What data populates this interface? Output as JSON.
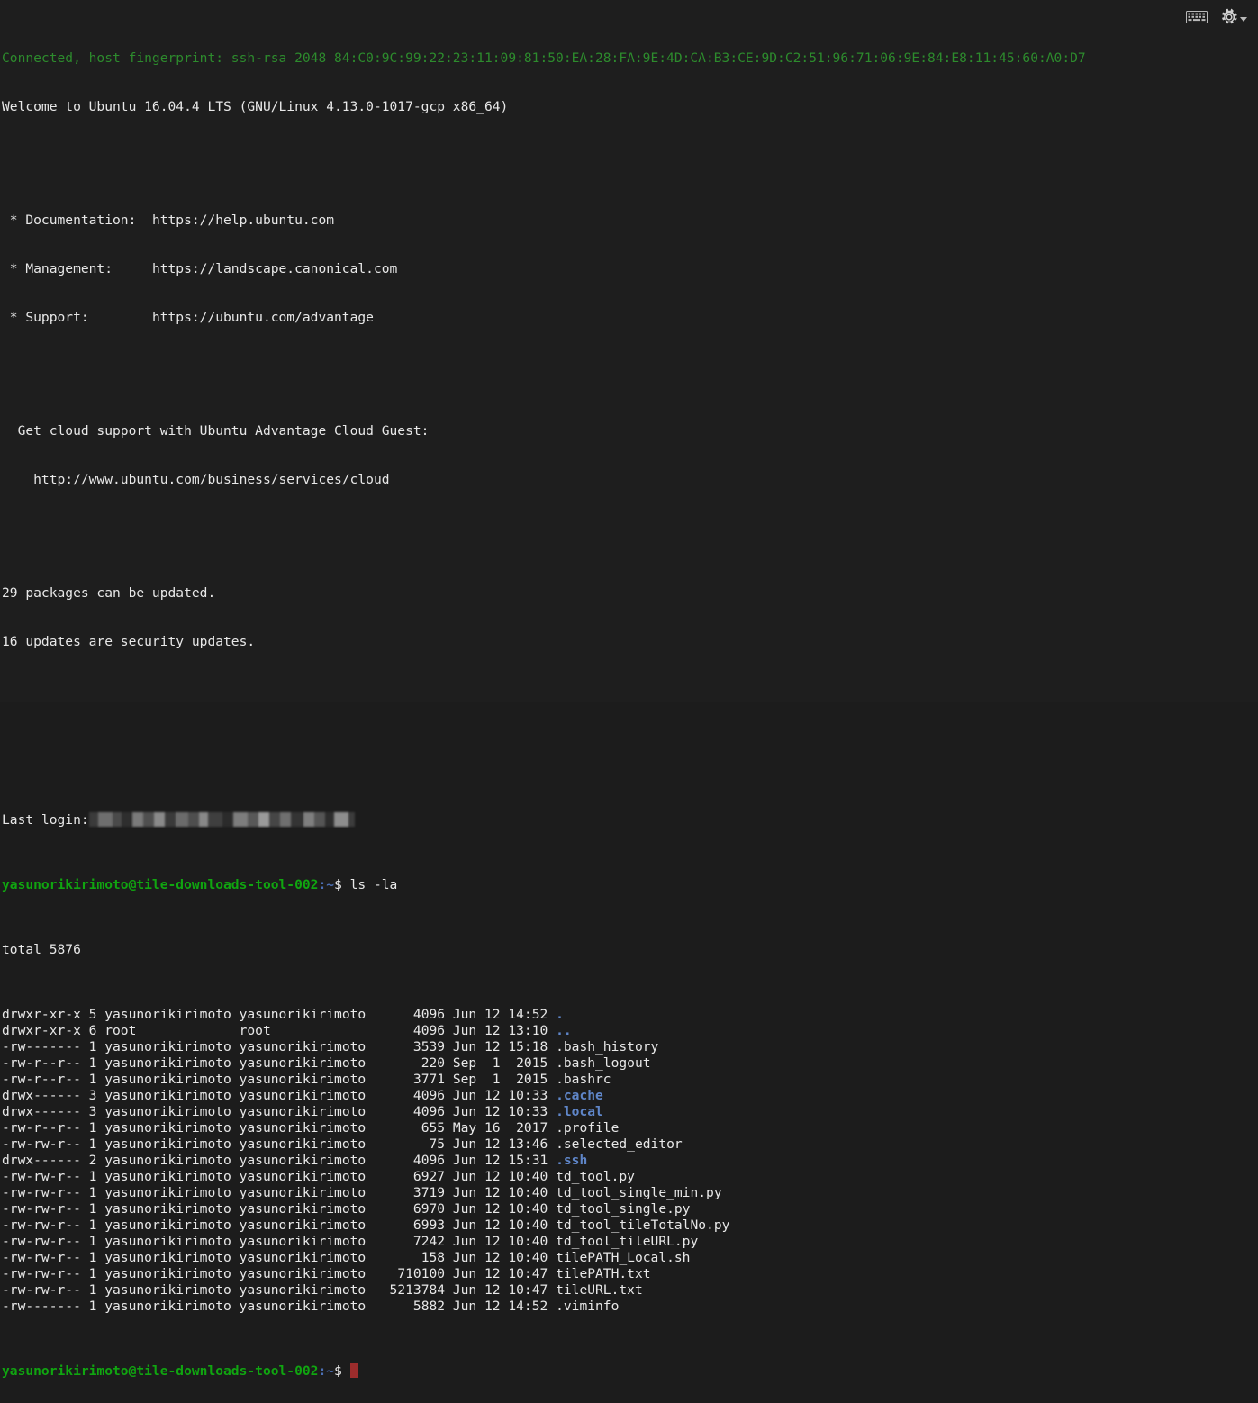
{
  "window": {
    "title": "SSH Terminal Session",
    "background_color": "#1e1e1e",
    "foreground_color": "#e6e6e6"
  },
  "toolbar": {
    "keyboard_icon": "keyboard-icon",
    "gear_icon": "gear-icon",
    "caret_icon": "chevron-down-icon"
  },
  "colors": {
    "prompt_green": "#10a510",
    "banner_green": "#2d8b2d",
    "directory_blue": "#5f86c9",
    "cursor_red": "#9c2c2c",
    "text_white": "#e8e8e8"
  },
  "banner": {
    "connected_line": "Connected, host fingerprint: ssh-rsa 2048 84:C0:9C:99:22:23:11:09:81:50:EA:28:FA:9E:4D:CA:B3:CE:9D:C2:51:96:71:06:9E:84:E8:11:45:60:A0:D7",
    "welcome_line": "Welcome to Ubuntu 16.04.4 LTS (GNU/Linux 4.13.0-1017-gcp x86_64)",
    "links": [
      {
        "label": " * Documentation:  ",
        "url": "https://help.ubuntu.com"
      },
      {
        "label": " * Management:     ",
        "url": "https://landscape.canonical.com"
      },
      {
        "label": " * Support:        ",
        "url": "https://ubuntu.com/advantage"
      }
    ],
    "cloud_support_line": "  Get cloud support with Ubuntu Advantage Cloud Guest:",
    "cloud_support_url": "    http://www.ubuntu.com/business/services/cloud",
    "packages_line": "29 packages can be updated.",
    "security_line": "16 updates are security updates.",
    "last_login_label": "Last login:",
    "last_login_value_redacted": true
  },
  "session": {
    "user": "yasunorikirimoto",
    "host": "tile-downloads-tool-002",
    "prompt_user_host": "yasunorikirimoto@tile-downloads-tool-002",
    "prompt_path": ":~",
    "prompt_symbol": "$",
    "command": " ls -la"
  },
  "listing": {
    "total_line": "total 5876",
    "rows": [
      {
        "perms": "drwxr-xr-x",
        "links": "5",
        "owner": "yasunorikirimoto",
        "group": "yasunorikirimoto",
        "size": "4096",
        "month": "Jun",
        "day": "12",
        "time": "14:52",
        "name": ".",
        "type": "dir"
      },
      {
        "perms": "drwxr-xr-x",
        "links": "6",
        "owner": "root",
        "group": "root",
        "size": "4096",
        "month": "Jun",
        "day": "12",
        "time": "13:10",
        "name": "..",
        "type": "dir"
      },
      {
        "perms": "-rw-------",
        "links": "1",
        "owner": "yasunorikirimoto",
        "group": "yasunorikirimoto",
        "size": "3539",
        "month": "Jun",
        "day": "12",
        "time": "15:18",
        "name": ".bash_history",
        "type": "file"
      },
      {
        "perms": "-rw-r--r--",
        "links": "1",
        "owner": "yasunorikirimoto",
        "group": "yasunorikirimoto",
        "size": "220",
        "month": "Sep",
        "day": "1",
        "time": "2015",
        "name": ".bash_logout",
        "type": "file"
      },
      {
        "perms": "-rw-r--r--",
        "links": "1",
        "owner": "yasunorikirimoto",
        "group": "yasunorikirimoto",
        "size": "3771",
        "month": "Sep",
        "day": "1",
        "time": "2015",
        "name": ".bashrc",
        "type": "file"
      },
      {
        "perms": "drwx------",
        "links": "3",
        "owner": "yasunorikirimoto",
        "group": "yasunorikirimoto",
        "size": "4096",
        "month": "Jun",
        "day": "12",
        "time": "10:33",
        "name": ".cache",
        "type": "dir"
      },
      {
        "perms": "drwx------",
        "links": "3",
        "owner": "yasunorikirimoto",
        "group": "yasunorikirimoto",
        "size": "4096",
        "month": "Jun",
        "day": "12",
        "time": "10:33",
        "name": ".local",
        "type": "dir"
      },
      {
        "perms": "-rw-r--r--",
        "links": "1",
        "owner": "yasunorikirimoto",
        "group": "yasunorikirimoto",
        "size": "655",
        "month": "May",
        "day": "16",
        "time": "2017",
        "name": ".profile",
        "type": "file"
      },
      {
        "perms": "-rw-rw-r--",
        "links": "1",
        "owner": "yasunorikirimoto",
        "group": "yasunorikirimoto",
        "size": "75",
        "month": "Jun",
        "day": "12",
        "time": "13:46",
        "name": ".selected_editor",
        "type": "file"
      },
      {
        "perms": "drwx------",
        "links": "2",
        "owner": "yasunorikirimoto",
        "group": "yasunorikirimoto",
        "size": "4096",
        "month": "Jun",
        "day": "12",
        "time": "15:31",
        "name": ".ssh",
        "type": "dir"
      },
      {
        "perms": "-rw-rw-r--",
        "links": "1",
        "owner": "yasunorikirimoto",
        "group": "yasunorikirimoto",
        "size": "6927",
        "month": "Jun",
        "day": "12",
        "time": "10:40",
        "name": "td_tool.py",
        "type": "file"
      },
      {
        "perms": "-rw-rw-r--",
        "links": "1",
        "owner": "yasunorikirimoto",
        "group": "yasunorikirimoto",
        "size": "3719",
        "month": "Jun",
        "day": "12",
        "time": "10:40",
        "name": "td_tool_single_min.py",
        "type": "file"
      },
      {
        "perms": "-rw-rw-r--",
        "links": "1",
        "owner": "yasunorikirimoto",
        "group": "yasunorikirimoto",
        "size": "6970",
        "month": "Jun",
        "day": "12",
        "time": "10:40",
        "name": "td_tool_single.py",
        "type": "file"
      },
      {
        "perms": "-rw-rw-r--",
        "links": "1",
        "owner": "yasunorikirimoto",
        "group": "yasunorikirimoto",
        "size": "6993",
        "month": "Jun",
        "day": "12",
        "time": "10:40",
        "name": "td_tool_tileTotalNo.py",
        "type": "file"
      },
      {
        "perms": "-rw-rw-r--",
        "links": "1",
        "owner": "yasunorikirimoto",
        "group": "yasunorikirimoto",
        "size": "7242",
        "month": "Jun",
        "day": "12",
        "time": "10:40",
        "name": "td_tool_tileURL.py",
        "type": "file"
      },
      {
        "perms": "-rw-rw-r--",
        "links": "1",
        "owner": "yasunorikirimoto",
        "group": "yasunorikirimoto",
        "size": "158",
        "month": "Jun",
        "day": "12",
        "time": "10:40",
        "name": "tilePATH_Local.sh",
        "type": "file"
      },
      {
        "perms": "-rw-rw-r--",
        "links": "1",
        "owner": "yasunorikirimoto",
        "group": "yasunorikirimoto",
        "size": "710100",
        "month": "Jun",
        "day": "12",
        "time": "10:47",
        "name": "tilePATH.txt",
        "type": "file"
      },
      {
        "perms": "-rw-rw-r--",
        "links": "1",
        "owner": "yasunorikirimoto",
        "group": "yasunorikirimoto",
        "size": "5213784",
        "month": "Jun",
        "day": "12",
        "time": "10:47",
        "name": "tileURL.txt",
        "type": "file"
      },
      {
        "perms": "-rw-------",
        "links": "1",
        "owner": "yasunorikirimoto",
        "group": "yasunorikirimoto",
        "size": "5882",
        "month": "Jun",
        "day": "12",
        "time": "14:52",
        "name": ".viminfo",
        "type": "file"
      }
    ]
  }
}
